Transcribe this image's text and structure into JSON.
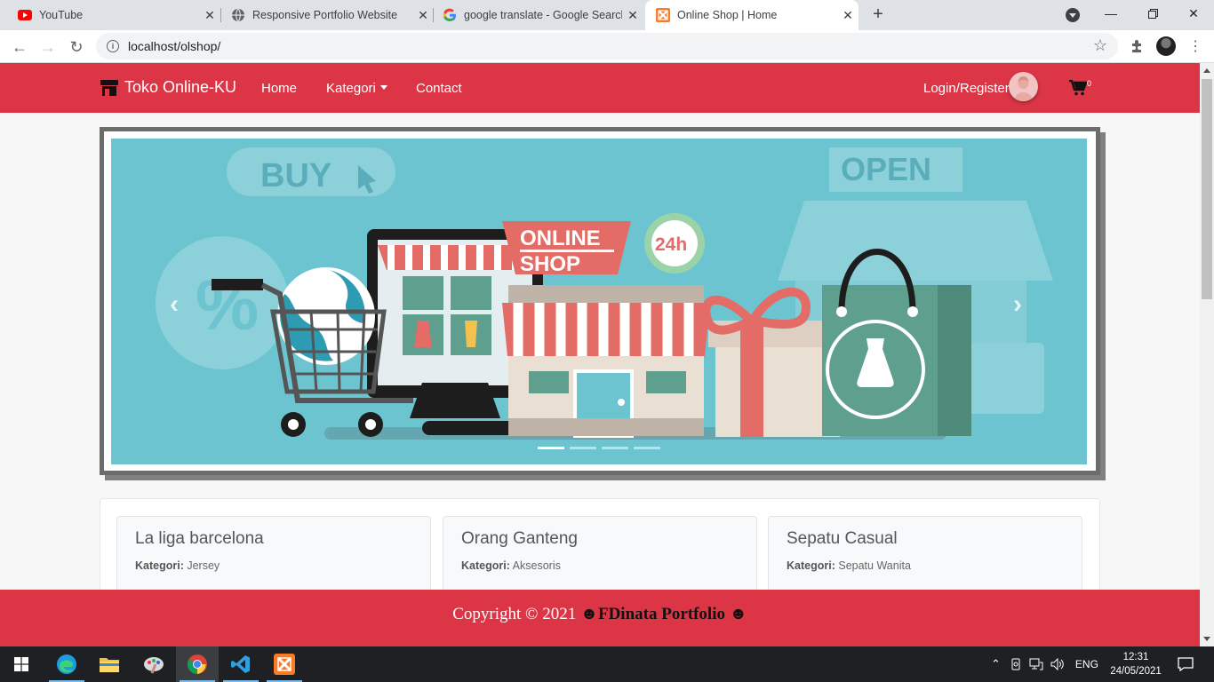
{
  "browser": {
    "tabs": [
      {
        "title": "YouTube",
        "icon": "youtube-icon"
      },
      {
        "title": "Responsive Portfolio Website",
        "icon": "globe-icon"
      },
      {
        "title": "google translate - Google Search",
        "icon": "google-icon"
      },
      {
        "title": "Online Shop | Home",
        "icon": "xampp-icon",
        "active": true
      }
    ],
    "url": "localhost/olshop/"
  },
  "site": {
    "brand": "Toko Online-KU",
    "nav": {
      "home": "Home",
      "kategori": "Kategori",
      "contact": "Contact"
    },
    "login": "Login/Register",
    "cart_count": "0",
    "banner": {
      "buy": "BUY",
      "open": "OPEN",
      "online": "ONLINE",
      "shop": "SHOP",
      "h24": "24h",
      "slides": 4,
      "active_slide": 1
    },
    "products": [
      {
        "name": "La liga barcelona",
        "cat_label": "Kategori:",
        "category": "Jersey"
      },
      {
        "name": "Orang Ganteng",
        "cat_label": "Kategori:",
        "category": "Aksesoris"
      },
      {
        "name": "Sepatu Casual",
        "cat_label": "Kategori:",
        "category": "Sepatu Wanita"
      }
    ],
    "footer": {
      "copyright": "Copyright © 2021",
      "brand": "FDinata Portfolio",
      "smile": "☻"
    },
    "colors": {
      "primary": "#dc3545",
      "banner_bg": "#6cc4d1"
    }
  },
  "taskbar": {
    "lang": "ENG",
    "time": "12:31",
    "date": "24/05/2021"
  }
}
